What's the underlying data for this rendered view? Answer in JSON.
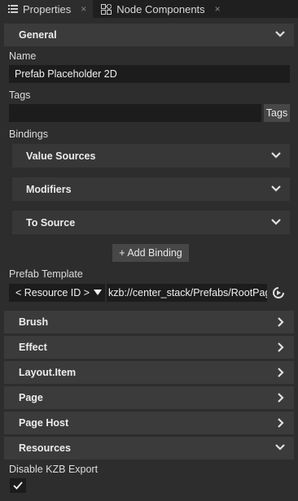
{
  "tabs": [
    {
      "label": "Properties",
      "active": true,
      "close": "×"
    },
    {
      "label": "Node Components",
      "active": false,
      "close": "×"
    }
  ],
  "general": {
    "header": "General",
    "name_label": "Name",
    "name_value": "Prefab Placeholder 2D",
    "tags_label": "Tags",
    "tags_value": "",
    "tags_button": "Tags",
    "bindings_label": "Bindings",
    "bindings": [
      {
        "label": "Value Sources"
      },
      {
        "label": "Modifiers"
      },
      {
        "label": "To Source"
      }
    ],
    "add_binding": "+ Add Binding",
    "prefab_template_label": "Prefab Template",
    "resource_id_select": "< Resource ID >",
    "prefab_template_value": "kzb://center_stack/Prefabs/RootPage"
  },
  "sections": [
    {
      "label": "Brush",
      "expanded": false
    },
    {
      "label": "Effect",
      "expanded": false
    },
    {
      "label": "Layout.Item",
      "expanded": false
    },
    {
      "label": "Page",
      "expanded": false
    },
    {
      "label": "Page Host",
      "expanded": false
    },
    {
      "label": "Resources",
      "expanded": true
    }
  ],
  "resources": {
    "disable_kzb_label": "Disable KZB Export",
    "disable_kzb_checked": true
  },
  "colors": {
    "background": "#2d2d2d",
    "section": "#3b3b3b",
    "subsection": "#373737",
    "field": "#1c1c1c",
    "text": "#e6e6e6"
  }
}
